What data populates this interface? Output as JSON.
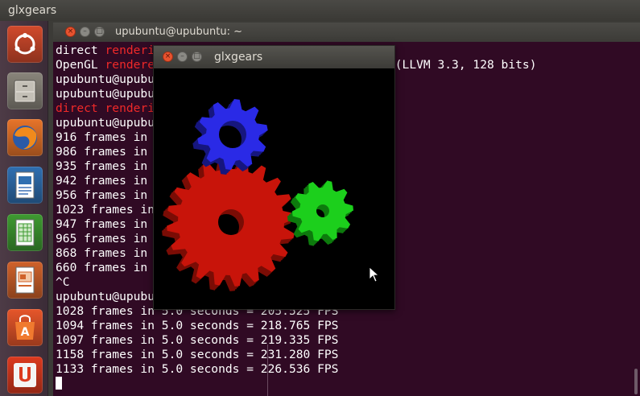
{
  "topbar": {
    "title": "glxgears"
  },
  "launcher": {
    "items": [
      {
        "name": "ubuntu-dash",
        "icon": "ubuntu-logo-icon",
        "color": "#d24a2c"
      },
      {
        "name": "files",
        "icon": "file-cabinet-icon",
        "color": "#8a857b"
      },
      {
        "name": "firefox",
        "icon": "firefox-icon",
        "color": "#e7742a"
      },
      {
        "name": "libreoffice-writer",
        "icon": "writer-document-icon",
        "color": "#2f6fb1"
      },
      {
        "name": "libreoffice-calc",
        "icon": "calc-spreadsheet-icon",
        "color": "#3e9a31"
      },
      {
        "name": "libreoffice-impress",
        "icon": "impress-presentation-icon",
        "color": "#d0622b"
      },
      {
        "name": "software-center",
        "icon": "shopping-bag-icon",
        "color": "#e6562a"
      },
      {
        "name": "ubuntu-one",
        "icon": "ubuntu-one-icon",
        "color": "#dc3a1f"
      }
    ]
  },
  "terminal": {
    "title": "upubuntu@upubuntu: ~",
    "lines": [
      [
        {
          "t": "direct "
        },
        {
          "t": "renderi",
          "red": true
        }
      ],
      [
        {
          "t": "OpenGL "
        },
        {
          "t": "rendere",
          "red": true
        },
        {
          "t": "                                  (LLVM 3.3, 128 bits)"
        }
      ],
      [
        {
          "t": "upubuntu@upubu"
        }
      ],
      [
        {
          "t": "upubuntu@upubu"
        }
      ],
      [
        {
          "t": "direct",
          "red": true
        },
        {
          "t": " "
        },
        {
          "t": "renderi",
          "red": true
        }
      ],
      [
        {
          "t": "upubuntu@upubu"
        }
      ],
      [
        {
          "t": "916 frames in"
        }
      ],
      [
        {
          "t": "986 frames in"
        }
      ],
      [
        {
          "t": "935 frames in"
        }
      ],
      [
        {
          "t": "942 frames in"
        }
      ],
      [
        {
          "t": "956 frames in"
        }
      ],
      [
        {
          "t": "1023 frames in"
        }
      ],
      [
        {
          "t": "947 frames in"
        }
      ],
      [
        {
          "t": "965 frames in"
        }
      ],
      [
        {
          "t": "868 frames in"
        }
      ],
      [
        {
          "t": "660 frames in"
        }
      ],
      [
        {
          "t": "^C"
        }
      ],
      [
        {
          "t": "upubuntu@upubu"
        }
      ],
      [
        {
          "t": "1028 frames in 5.0 seconds = 205.525 FPS"
        }
      ],
      [
        {
          "t": "1094 frames in 5.0 seconds = 218.765 FPS"
        }
      ],
      [
        {
          "t": "1097 frames in 5.0 seconds = 219.335 FPS"
        }
      ],
      [
        {
          "t": "1158 frames in 5.0 seconds = 231.280 FPS"
        }
      ],
      [
        {
          "t": "1133 frames in 5.0 seconds = 226.536 FPS"
        }
      ]
    ]
  },
  "glxgears": {
    "title": "glxgears",
    "gears": [
      {
        "name": "red-gear",
        "color": "#c8140a",
        "side": "#7a0c05"
      },
      {
        "name": "green-gear",
        "color": "#1ccf1c",
        "side": "#0d7a0d"
      },
      {
        "name": "blue-gear",
        "color": "#2a2ae6",
        "side": "#16167e"
      }
    ]
  },
  "window_buttons": {
    "close": "×",
    "minimize": "–",
    "maximize": "□"
  }
}
